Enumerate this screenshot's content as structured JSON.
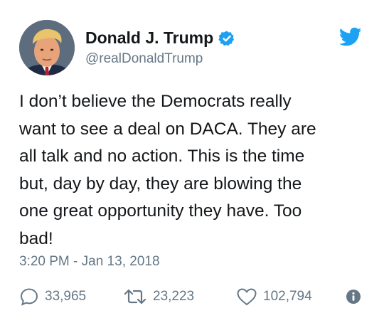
{
  "user": {
    "display_name": "Donald J. Trump",
    "handle": "@realDonaldTrump",
    "verified": true,
    "avatar_icon": "profile-photo"
  },
  "tweet": {
    "lines": [
      "I don’t believe the Democrats really",
      "want to see a deal on DACA. They are",
      "all talk and no action. This is the time",
      "but, day by day, they are blowing the",
      "one great opportunity they have. Too",
      "bad!"
    ],
    "timestamp": "3:20 PM - Jan 13, 2018"
  },
  "actions": {
    "replies": "33,965",
    "retweets": "23,223",
    "likes": "102,794"
  },
  "icons": {
    "brand": "twitter-bird-icon",
    "verified": "verified-badge-icon",
    "reply": "reply-icon",
    "retweet": "retweet-icon",
    "like": "heart-icon",
    "info": "info-icon"
  },
  "colors": {
    "brand_blue": "#1da1f2",
    "text": "#14171a",
    "secondary": "#657786"
  }
}
